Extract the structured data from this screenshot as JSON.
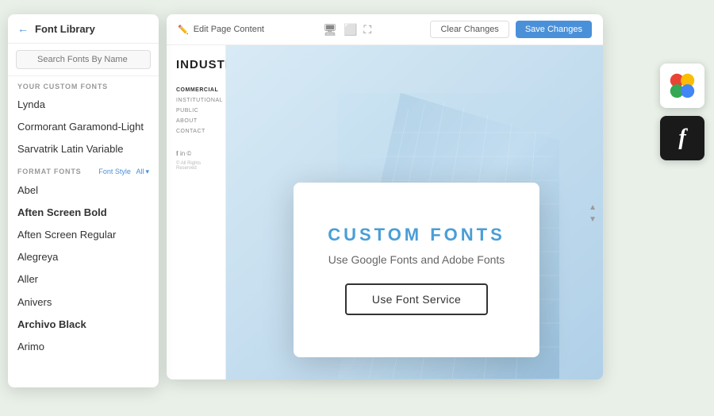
{
  "fontLibrary": {
    "title": "Font Library",
    "backArrow": "←",
    "search": {
      "placeholder": "Search Fonts By Name"
    },
    "customFontsLabel": "YOUR CUSTOM FONTS",
    "customFonts": [
      {
        "name": "Lynda",
        "bold": false
      },
      {
        "name": "Cormorant Garamond-Light",
        "bold": false
      },
      {
        "name": "Sarvatrik Latin Variable",
        "bold": false
      }
    ],
    "formatFontsLabel": "FORMAT FONTS",
    "fontStyleLabel": "Font Style",
    "fontStyleValue": "All",
    "formatFonts": [
      {
        "name": "Abel",
        "bold": false
      },
      {
        "name": "Aften Screen Bold",
        "bold": true
      },
      {
        "name": "Aften Screen Regular",
        "bold": false
      },
      {
        "name": "Alegreya",
        "bold": false
      },
      {
        "name": "Aller",
        "bold": false
      },
      {
        "name": "Anivers",
        "bold": false
      },
      {
        "name": "Archivo Black",
        "bold": true
      },
      {
        "name": "Arimo",
        "bold": false
      }
    ]
  },
  "editor": {
    "title": "Edit Page Content",
    "clearBtn": "Clear Changes",
    "saveBtn": "Save Changes",
    "icons": {
      "monitor": "🖥",
      "tablet": "⬜",
      "expand": "⛶"
    }
  },
  "website": {
    "logo": "INDUSTRY",
    "navItems": [
      {
        "label": "COMMERCIAL",
        "active": true
      },
      {
        "label": "INSTITUTIONAL",
        "active": false
      },
      {
        "label": "PUBLIC",
        "active": false
      },
      {
        "label": "ABOUT",
        "active": false
      },
      {
        "label": "CONTACT",
        "active": false
      }
    ],
    "socialIcons": [
      "f",
      "in",
      "©"
    ],
    "copyright": "© All Rights Reserved"
  },
  "modal": {
    "title": "CUSTOM  FONTS",
    "subtitle": "Use Google Fonts and Adobe Fonts",
    "buttonLabel": "Use Font Service"
  },
  "serviceIcons": {
    "google": "Google Fonts",
    "adobe": "Adobe Fonts"
  }
}
